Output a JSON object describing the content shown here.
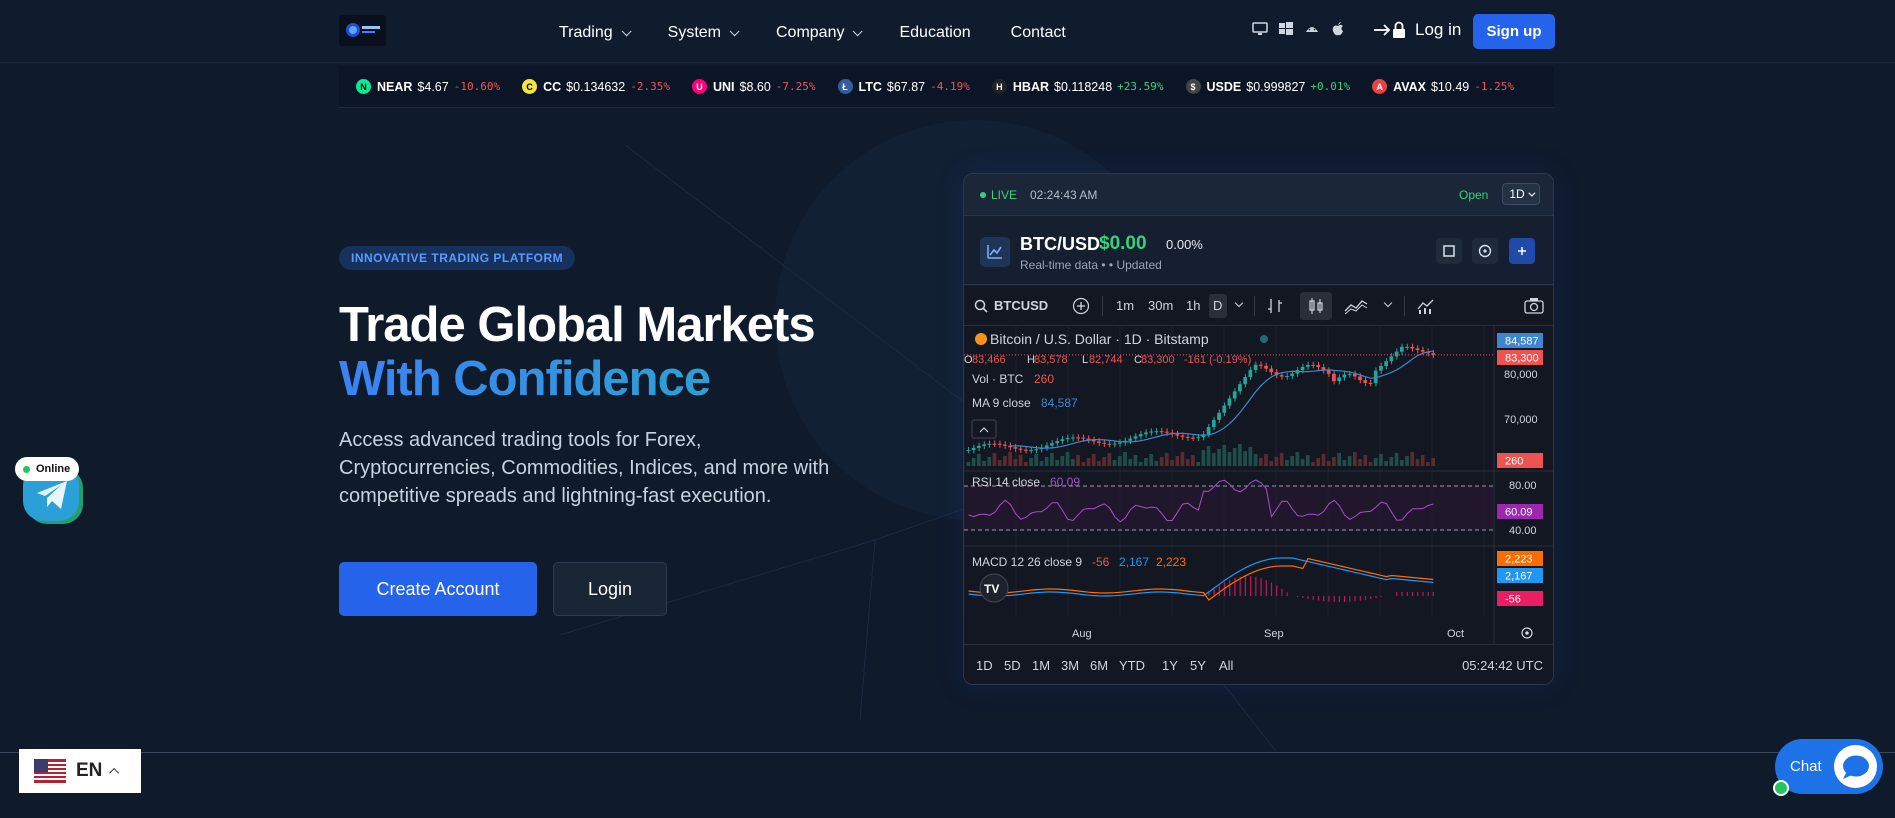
{
  "header": {
    "nav": [
      {
        "label": "Trading",
        "dropdown": true
      },
      {
        "label": "System",
        "dropdown": true
      },
      {
        "label": "Company",
        "dropdown": true
      },
      {
        "label": "Education",
        "dropdown": false
      },
      {
        "label": "Contact",
        "dropdown": false
      }
    ],
    "platforms": [
      "desktop-icon",
      "windows-icon",
      "android-icon",
      "apple-icon"
    ],
    "login_label": "Log in",
    "signup_label": "Sign up"
  },
  "ticker": [
    {
      "symbol": "NEAR",
      "price": "$4.67",
      "change": "-10.60%",
      "dir": "neg",
      "color": "#00ec97",
      "glyph": "N"
    },
    {
      "symbol": "CC",
      "price": "$0.134632",
      "change": "-2.35%",
      "dir": "neg",
      "color": "#f4e542",
      "glyph": "C"
    },
    {
      "symbol": "UNI",
      "price": "$8.60",
      "change": "-7.25%",
      "dir": "neg",
      "color": "#ff007a",
      "glyph": "U"
    },
    {
      "symbol": "LTC",
      "price": "$67.87",
      "change": "-4.19%",
      "dir": "neg",
      "color": "#345d9d",
      "glyph": "Ł"
    },
    {
      "symbol": "HBAR",
      "price": "$0.118248",
      "change": "+23.59%",
      "dir": "pos",
      "color": "#222222",
      "glyph": "H"
    },
    {
      "symbol": "USDE",
      "price": "$0.999827",
      "change": "+0.01%",
      "dir": "pos",
      "color": "#444444",
      "glyph": "$"
    },
    {
      "symbol": "AVAX",
      "price": "$10.49",
      "change": "-1.25%",
      "dir": "neg",
      "color": "#e84142",
      "glyph": "A"
    }
  ],
  "hero": {
    "badge": "INNOVATIVE TRADING PLATFORM",
    "title_line1": "Trade Global Markets",
    "title_line2": "With Confidence",
    "description": "Access advanced trading tools for Forex, Cryptocurrencies, Commodities, Indices, and more with competitive spreads and lightning-fast execution.",
    "create_label": "Create Account",
    "login_label": "Login"
  },
  "widget": {
    "live_label": "LIVE",
    "live_time": "02:24:43 AM",
    "open_label": "Open",
    "timeframe": "1D",
    "pair": "BTC/USD",
    "price": "$0.00",
    "change": "0.00%",
    "sub": "Real-time data •  • Updated",
    "chart": {
      "symbol": "BTCUSD",
      "intervals": [
        "1m",
        "30m",
        "1h",
        "D"
      ],
      "legend_title": "Bitcoin / U.S. Dollar · 1D · Bitstamp",
      "ohlc": {
        "o": "83,466",
        "h": "83,578",
        "l": "82,744",
        "c": "83,300",
        "chg": "-161 (-0.19%)"
      },
      "vol_label": "Vol · BTC",
      "vol_value": "260",
      "ma_label": "MA 9 close",
      "ma_value": "84,587",
      "rsi_label": "RSI 14 close",
      "rsi_value": "60.09",
      "macd_label": "MACD 12 26 close 9",
      "macd_v1": "-56",
      "macd_v2": "2,167",
      "macd_v3": "2,223",
      "price_tags": {
        "ma": "84,587",
        "last": "83,300",
        "vol": "260",
        "rsi": "60.09",
        "macd_a": "2,223",
        "macd_b": "2,167",
        "macd_h": "-56"
      },
      "axis_price": [
        "80,000",
        "70,000"
      ],
      "axis_rsi": [
        "80.00",
        "40.00"
      ],
      "months": [
        "Aug",
        "Sep",
        "Oct"
      ],
      "ranges": [
        "1D",
        "5D",
        "1M",
        "3M",
        "6M",
        "YTD",
        "1Y",
        "5Y",
        "All"
      ],
      "utc_time": "05:24:42 UTC",
      "logo_text": "TV"
    }
  },
  "floating": {
    "online_label": "Online",
    "lang_label": "EN",
    "chat_label": "Chat"
  },
  "colors": {
    "accent": "#2563eb",
    "up": "#26a69a",
    "down": "#ef5350",
    "positive": "#34d27a"
  }
}
